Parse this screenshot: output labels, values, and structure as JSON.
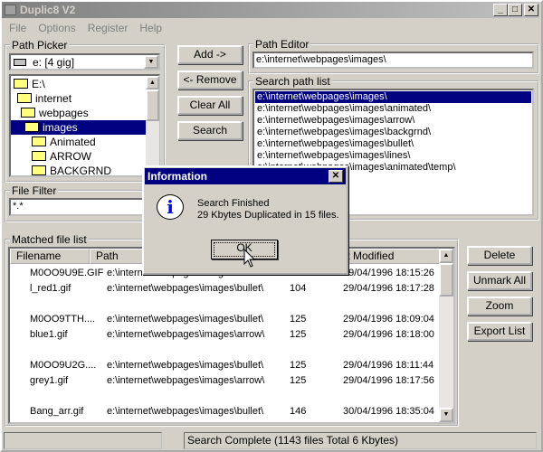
{
  "window": {
    "title": "Duplic8 V2",
    "controls": {
      "minimize": "_",
      "maximize": "□",
      "close": "✕"
    }
  },
  "menu": [
    "File",
    "Options",
    "Register",
    "Help"
  ],
  "path_picker": {
    "label": "Path Picker",
    "drive": "e: [4 gig]",
    "tree": [
      {
        "label": "E:\\",
        "level": 0,
        "open": true
      },
      {
        "label": "internet",
        "level": 1,
        "open": true
      },
      {
        "label": "webpages",
        "level": 2,
        "open": true
      },
      {
        "label": "images",
        "level": 3,
        "open": true,
        "selected": true
      },
      {
        "label": "Animated",
        "level": 4
      },
      {
        "label": "ARROW",
        "level": 4
      },
      {
        "label": "BACKGRND",
        "level": 4
      }
    ]
  },
  "buttons": {
    "add": "Add ->",
    "remove": "<- Remove",
    "clear_all": "Clear All",
    "search": "Search",
    "delete": "Delete",
    "unmark_all": "Unmark All",
    "zoom": "Zoom",
    "export_list": "Export List"
  },
  "path_editor": {
    "label": "Path Editor",
    "value": "e:\\internet\\webpages\\images\\"
  },
  "search_path_list": {
    "label": "Search path list",
    "items": [
      "e:\\internet\\webpages\\images\\",
      "e:\\internet\\webpages\\images\\animated\\",
      "e:\\internet\\webpages\\images\\arrow\\",
      "e:\\internet\\webpages\\images\\backgrnd\\",
      "e:\\internet\\webpages\\images\\bullet\\",
      "e:\\internet\\webpages\\images\\lines\\",
      "e:\\internet\\webpages\\images\\animated\\temp\\"
    ],
    "selected": 0
  },
  "file_filter": {
    "label": "File Filter",
    "value": "*.*"
  },
  "matched": {
    "label": "Matched file list",
    "columns": [
      "Filename",
      "Path",
      "",
      "Last Modified"
    ],
    "rows": [
      {
        "name": "M0OO9U9E.GIF",
        "path": "e:\\internet\\webpages\\images\\bullet\\",
        "size": "104",
        "modified": "29/04/1996 18:15:26"
      },
      {
        "name": "l_red1.gif",
        "path": "e:\\internet\\webpages\\images\\bullet\\",
        "size": "104",
        "modified": "29/04/1996 18:17:28"
      },
      {
        "name": "M0OO9TTH....",
        "path": "e:\\internet\\webpages\\images\\bullet\\",
        "size": "125",
        "modified": "29/04/1996 18:09:04"
      },
      {
        "name": "blue1.gif",
        "path": "e:\\internet\\webpages\\images\\arrow\\",
        "size": "125",
        "modified": "29/04/1996 18:18:00"
      },
      {
        "name": "M0OO9U2G....",
        "path": "e:\\internet\\webpages\\images\\bullet\\",
        "size": "125",
        "modified": "29/04/1996 18:11:44"
      },
      {
        "name": "grey1.gif",
        "path": "e:\\internet\\webpages\\images\\arrow\\",
        "size": "125",
        "modified": "29/04/1996 18:17:56"
      },
      {
        "name": "Bang_arr.gif",
        "path": "e:\\internet\\webpages\\images\\bullet\\",
        "size": "146",
        "modified": "30/04/1996 18:35:04"
      }
    ]
  },
  "status": {
    "left": "",
    "right": "Search Complete (1143 files  Total 6 Kbytes)"
  },
  "dialog": {
    "title": "Information",
    "line1": "Search Finished",
    "line2": "29 Kbytes Duplicated in 15 files.",
    "ok": "OK",
    "icon": "information-icon"
  }
}
